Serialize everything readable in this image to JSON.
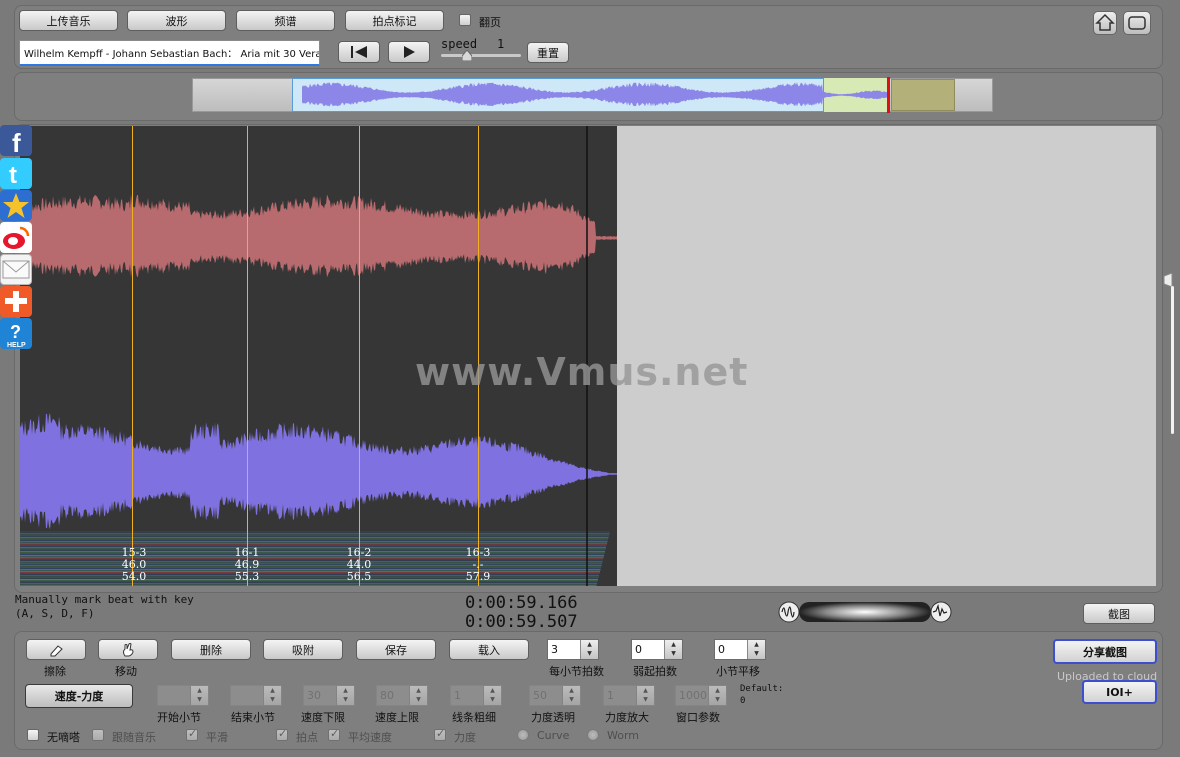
{
  "toolbar": {
    "upload_label": "上传音乐",
    "waveform_label": "波形",
    "spectrum_label": "频谱",
    "beat_mark_label": "拍点标记",
    "page_turn_label": "翻页",
    "track_title": "Wilhelm Kempff - Johann Sebastian Bach：  Aria mit 30 Vera",
    "speed_label": "speed",
    "speed_value": "1",
    "reset_label": "重置"
  },
  "watermark": "www.Vmus.net",
  "beat_markers": [
    {
      "bar": "15-3",
      "tempo": "46.0",
      "dynamics": "54.0"
    },
    {
      "bar": "16-1",
      "tempo": "46.9",
      "dynamics": "55.3"
    },
    {
      "bar": "16-2",
      "tempo": "44.0",
      "dynamics": "56.5"
    },
    {
      "bar": "16-3",
      "tempo": "-.-",
      "dynamics": "57.9"
    }
  ],
  "status": {
    "hint_line1": "Manually mark beat with key",
    "hint_line2": "(A, S, D, F)",
    "time_current": "0:00:59.166",
    "time_total": "0:00:59.507",
    "screenshot_label": "截图"
  },
  "controls": {
    "erase_label": "擦除",
    "move_label": "移动",
    "delete_label": "删除",
    "attach_label": "吸附",
    "save_label": "保存",
    "load_label": "载入",
    "beats_per_bar_value": "3",
    "beats_per_bar_label": "每小节拍数",
    "pickup_value": "0",
    "pickup_label": "弱起拍数",
    "bar_shift_value": "0",
    "bar_shift_label": "小节平移",
    "tempo_dynamics_label": "速度-力度",
    "start_bar_label": "开始小节",
    "end_bar_label": "结束小节",
    "tempo_min_label": "速度下限",
    "tempo_max_label": "速度上限",
    "line_width_label": "线条粗细",
    "dyn_alpha_label": "力度透明",
    "dyn_zoom_label": "力度放大",
    "window_param_label": "窗口参数",
    "tempo_min_value": "30",
    "tempo_max_value": "80",
    "line_width_value": "1",
    "dyn_alpha_value": "50",
    "dyn_zoom_value": "1",
    "window_param_value": "1000",
    "default_label": "Default:",
    "default_value": "0",
    "no_tick_label": "无嘀嗒",
    "follow_music_label": "跟随音乐",
    "smooth_label": "平滑",
    "beat_label": "拍点",
    "avg_tempo_label": "平均速度",
    "dynamics_label": "力度",
    "curve_label": "Curve",
    "worm_label": "Worm",
    "share_label": "分享截图",
    "uploaded_label": "Uploaded to cloud",
    "ioi_label": "IOI+"
  },
  "colors": {
    "waveform_top": "#b86b6e",
    "waveform_bottom": "#7f72e0",
    "beat_line": "#f0b020",
    "panel_dark": "#363636",
    "share_border": "#3b4fd0"
  }
}
